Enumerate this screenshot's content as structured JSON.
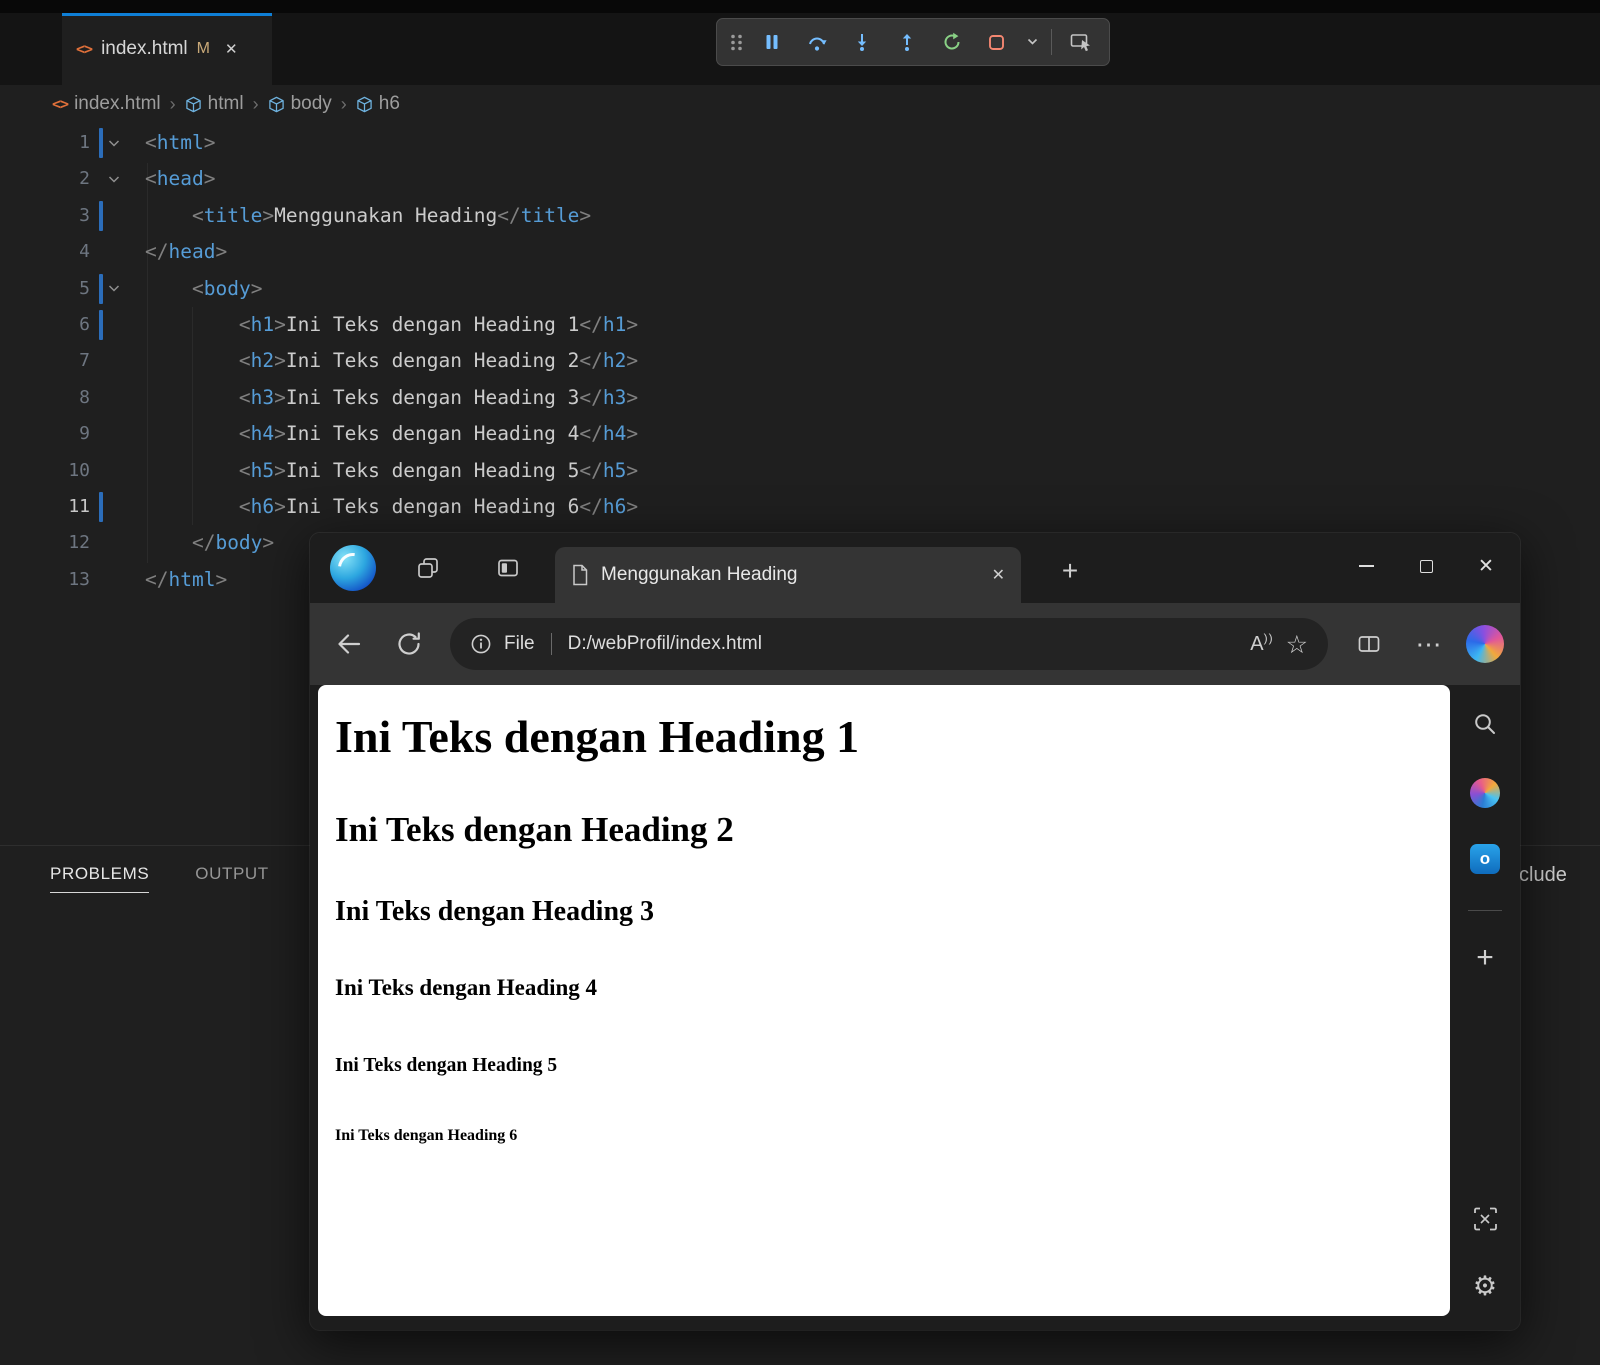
{
  "colors": {
    "accent_blue": "#0f7fd6",
    "tag_blue": "#569cd6",
    "punctuation_gray": "#808080",
    "git_modified_blue": "#2e7bd6",
    "debug_step_blue": "#75beff",
    "debug_restart_green": "#89d185",
    "debug_stop_red": "#f48771"
  },
  "glyphs": {
    "close": "✕",
    "plus": "+",
    "more": "⋯",
    "star": "☆",
    "gear": "⚙",
    "read_aloud": "A",
    "read_aloud_waves": "))",
    "breadcrumb_separator": "›",
    "html_file_icon": "<>"
  },
  "vscode": {
    "tab": {
      "title": "index.html",
      "badge": "M"
    },
    "debug_toolbar": {
      "icons": [
        "drag-handle",
        "pause",
        "step-over",
        "step-into",
        "step-out",
        "restart",
        "stop",
        "stop-dropdown",
        "inspect"
      ]
    },
    "breadcrumb": {
      "file": "index.html",
      "symbols": [
        "html",
        "body",
        "h6"
      ]
    },
    "editor": {
      "lines": [
        {
          "n": 1,
          "ind": 0,
          "fold": true,
          "git": true,
          "segs": [
            [
              "p",
              "<"
            ],
            [
              "t",
              "html"
            ],
            [
              "p",
              ">"
            ]
          ]
        },
        {
          "n": 2,
          "ind": 0,
          "fold": true,
          "segs": [
            [
              "p",
              "<"
            ],
            [
              "t",
              "head"
            ],
            [
              "p",
              ">"
            ]
          ]
        },
        {
          "n": 3,
          "ind": 4,
          "git": true,
          "segs": [
            [
              "p",
              "<"
            ],
            [
              "t",
              "title"
            ],
            [
              "p",
              ">"
            ],
            [
              "x",
              "Menggunakan Heading"
            ],
            [
              "p",
              "</"
            ],
            [
              "t",
              "title"
            ],
            [
              "p",
              ">"
            ]
          ]
        },
        {
          "n": 4,
          "ind": 0,
          "segs": [
            [
              "p",
              "</"
            ],
            [
              "t",
              "head"
            ],
            [
              "p",
              ">"
            ]
          ]
        },
        {
          "n": 5,
          "ind": 4,
          "fold": true,
          "git": true,
          "segs": [
            [
              "p",
              "<"
            ],
            [
              "t",
              "body"
            ],
            [
              "p",
              ">"
            ]
          ]
        },
        {
          "n": 6,
          "ind": 8,
          "git": true,
          "segs": [
            [
              "p",
              "<"
            ],
            [
              "t",
              "h1"
            ],
            [
              "p",
              ">"
            ],
            [
              "x",
              "Ini Teks dengan Heading 1"
            ],
            [
              "p",
              "</"
            ],
            [
              "t",
              "h1"
            ],
            [
              "p",
              ">"
            ]
          ]
        },
        {
          "n": 7,
          "ind": 8,
          "segs": [
            [
              "p",
              "<"
            ],
            [
              "t",
              "h2"
            ],
            [
              "p",
              ">"
            ],
            [
              "x",
              "Ini Teks dengan Heading 2"
            ],
            [
              "p",
              "</"
            ],
            [
              "t",
              "h2"
            ],
            [
              "p",
              ">"
            ]
          ]
        },
        {
          "n": 8,
          "ind": 8,
          "segs": [
            [
              "p",
              "<"
            ],
            [
              "t",
              "h3"
            ],
            [
              "p",
              ">"
            ],
            [
              "x",
              "Ini Teks dengan Heading 3"
            ],
            [
              "p",
              "</"
            ],
            [
              "t",
              "h3"
            ],
            [
              "p",
              ">"
            ]
          ]
        },
        {
          "n": 9,
          "ind": 8,
          "segs": [
            [
              "p",
              "<"
            ],
            [
              "t",
              "h4"
            ],
            [
              "p",
              ">"
            ],
            [
              "x",
              "Ini Teks dengan Heading 4"
            ],
            [
              "p",
              "</"
            ],
            [
              "t",
              "h4"
            ],
            [
              "p",
              ">"
            ]
          ]
        },
        {
          "n": 10,
          "ind": 8,
          "segs": [
            [
              "p",
              "<"
            ],
            [
              "t",
              "h5"
            ],
            [
              "p",
              ">"
            ],
            [
              "x",
              "Ini Teks dengan Heading 5"
            ],
            [
              "p",
              "</"
            ],
            [
              "t",
              "h5"
            ],
            [
              "p",
              ">"
            ]
          ]
        },
        {
          "n": 11,
          "ind": 8,
          "git": true,
          "current": true,
          "segs": [
            [
              "p",
              "<"
            ],
            [
              "t",
              "h6"
            ],
            [
              "p",
              ">"
            ],
            [
              "x",
              "Ini Teks dengan Heading 6"
            ],
            [
              "p",
              "</"
            ],
            [
              "t",
              "h6"
            ],
            [
              "p",
              ">"
            ]
          ]
        },
        {
          "n": 12,
          "ind": 4,
          "segs": [
            [
              "p",
              "</"
            ],
            [
              "t",
              "body"
            ],
            [
              "p",
              ">"
            ]
          ]
        },
        {
          "n": 13,
          "ind": 0,
          "segs": [
            [
              "p",
              "</"
            ],
            [
              "t",
              "html"
            ],
            [
              "p",
              ">"
            ]
          ]
        }
      ]
    },
    "panel": {
      "tabs": [
        "PROBLEMS",
        "OUTPUT"
      ],
      "active": "PROBLEMS"
    },
    "occluded_fragment": "clude"
  },
  "browser": {
    "tabstrip": {
      "icons": [
        "browser-logo",
        "tab-group",
        "vertical-tabs"
      ],
      "tab": {
        "title": "Menggunakan Heading"
      },
      "window_controls": [
        "minimize",
        "maximize",
        "close"
      ]
    },
    "toolbar": {
      "icons": [
        "back",
        "refresh",
        "split-screen",
        "more",
        "copilot"
      ],
      "address": {
        "prefix": "File",
        "url": "D:/webProfil/index.html"
      }
    },
    "sidebar": {
      "icons": [
        "search",
        "m365",
        "outlook",
        "add",
        "screenshot",
        "settings"
      ]
    },
    "page": {
      "headings": [
        {
          "tag": "h1",
          "text": "Ini Teks dengan Heading 1"
        },
        {
          "tag": "h2",
          "text": "Ini Teks dengan Heading 2"
        },
        {
          "tag": "h3",
          "text": "Ini Teks dengan Heading 3"
        },
        {
          "tag": "h4",
          "text": "Ini Teks dengan Heading 4"
        },
        {
          "tag": "h5",
          "text": "Ini Teks dengan Heading 5"
        },
        {
          "tag": "h6",
          "text": "Ini Teks dengan Heading 6"
        }
      ]
    }
  }
}
